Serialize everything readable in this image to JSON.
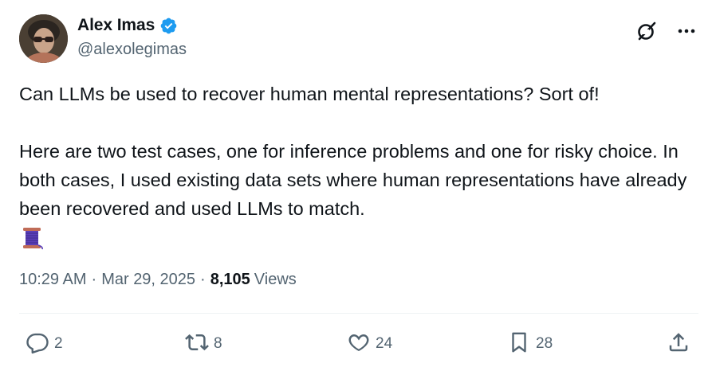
{
  "author": {
    "display_name": "Alex Imas",
    "handle": "@alexolegimas",
    "verified": true
  },
  "post": {
    "text": "Can LLMs be used to recover human mental representations? Sort of!\n\nHere are two test cases, one for inference problems and one for risky choice. In both cases, I used existing data sets where human representations have already been recovered and used LLMs to match.",
    "emoji": "thread-spool-emoji"
  },
  "meta": {
    "time": "10:29 AM",
    "separator1": "·",
    "date": "Mar 29, 2025",
    "separator2": "·",
    "views_count": "8,105",
    "views_label": "Views"
  },
  "actions": {
    "replies": "2",
    "reposts": "8",
    "likes": "24",
    "bookmarks": "28"
  },
  "icons": [
    "verified-badge-icon",
    "grok-icon",
    "more-icon",
    "reply-icon",
    "repost-icon",
    "like-icon",
    "bookmark-icon",
    "share-icon"
  ],
  "colors": {
    "text_primary": "#0f1419",
    "text_secondary": "#536471",
    "verified_blue": "#1d9bf0",
    "divider": "#eff3f4"
  }
}
